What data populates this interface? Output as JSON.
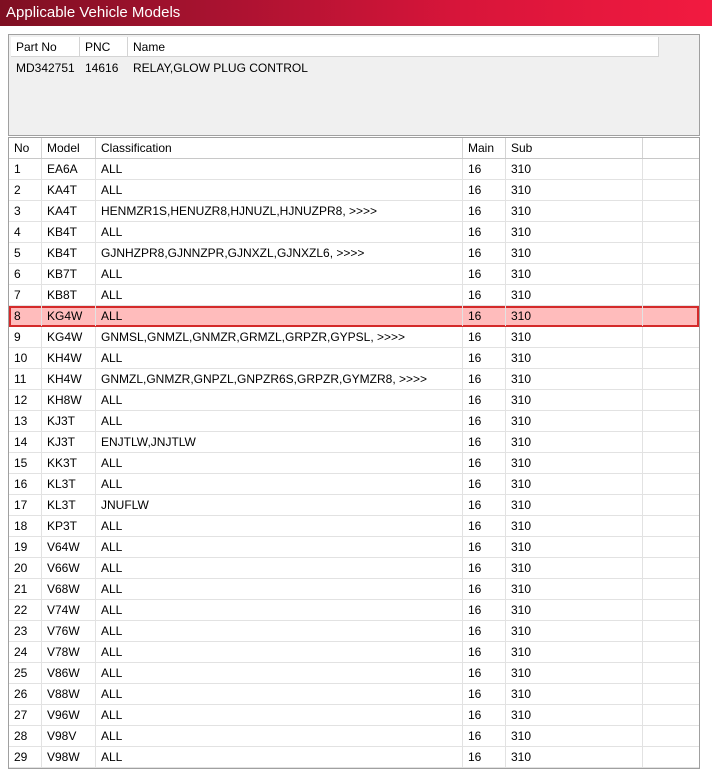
{
  "window": {
    "title": "Applicable Vehicle Models"
  },
  "part_panel": {
    "headers": {
      "part_no": "Part No",
      "pnc": "PNC",
      "name": "Name"
    },
    "row": {
      "part_no": "MD342751",
      "pnc": "14616",
      "name": "RELAY,GLOW PLUG CONTROL"
    }
  },
  "models_table": {
    "headers": {
      "no": "No",
      "model": "Model",
      "classification": "Classification",
      "main": "Main",
      "sub": "Sub"
    },
    "selected_index": 7,
    "rows": [
      {
        "no": "1",
        "model": "EA6A",
        "classification": "ALL",
        "main": "16",
        "sub": "310"
      },
      {
        "no": "2",
        "model": "KA4T",
        "classification": "ALL",
        "main": "16",
        "sub": "310"
      },
      {
        "no": "3",
        "model": "KA4T",
        "classification": "HENMZR1S,HENUZR8,HJNUZL,HJNUZPR8,  >>>>",
        "main": "16",
        "sub": "310"
      },
      {
        "no": "4",
        "model": "KB4T",
        "classification": "ALL",
        "main": "16",
        "sub": "310"
      },
      {
        "no": "5",
        "model": "KB4T",
        "classification": "GJNHZPR8,GJNNZPR,GJNXZL,GJNXZL6,  >>>>",
        "main": "16",
        "sub": "310"
      },
      {
        "no": "6",
        "model": "KB7T",
        "classification": "ALL",
        "main": "16",
        "sub": "310"
      },
      {
        "no": "7",
        "model": "KB8T",
        "classification": "ALL",
        "main": "16",
        "sub": "310"
      },
      {
        "no": "8",
        "model": "KG4W",
        "classification": "ALL",
        "main": "16",
        "sub": "310"
      },
      {
        "no": "9",
        "model": "KG4W",
        "classification": "GNMSL,GNMZL,GNMZR,GRMZL,GRPZR,GYPSL,  >>>>",
        "main": "16",
        "sub": "310"
      },
      {
        "no": "10",
        "model": "KH4W",
        "classification": "ALL",
        "main": "16",
        "sub": "310"
      },
      {
        "no": "11",
        "model": "KH4W",
        "classification": "GNMZL,GNMZR,GNPZL,GNPZR6S,GRPZR,GYMZR8,  >>>>",
        "main": "16",
        "sub": "310"
      },
      {
        "no": "12",
        "model": "KH8W",
        "classification": "ALL",
        "main": "16",
        "sub": "310"
      },
      {
        "no": "13",
        "model": "KJ3T",
        "classification": "ALL",
        "main": "16",
        "sub": "310"
      },
      {
        "no": "14",
        "model": "KJ3T",
        "classification": "ENJTLW,JNJTLW",
        "main": "16",
        "sub": "310"
      },
      {
        "no": "15",
        "model": "KK3T",
        "classification": "ALL",
        "main": "16",
        "sub": "310"
      },
      {
        "no": "16",
        "model": "KL3T",
        "classification": "ALL",
        "main": "16",
        "sub": "310"
      },
      {
        "no": "17",
        "model": "KL3T",
        "classification": "JNUFLW",
        "main": "16",
        "sub": "310"
      },
      {
        "no": "18",
        "model": "KP3T",
        "classification": "ALL",
        "main": "16",
        "sub": "310"
      },
      {
        "no": "19",
        "model": "V64W",
        "classification": "ALL",
        "main": "16",
        "sub": "310"
      },
      {
        "no": "20",
        "model": "V66W",
        "classification": "ALL",
        "main": "16",
        "sub": "310"
      },
      {
        "no": "21",
        "model": "V68W",
        "classification": "ALL",
        "main": "16",
        "sub": "310"
      },
      {
        "no": "22",
        "model": "V74W",
        "classification": "ALL",
        "main": "16",
        "sub": "310"
      },
      {
        "no": "23",
        "model": "V76W",
        "classification": "ALL",
        "main": "16",
        "sub": "310"
      },
      {
        "no": "24",
        "model": "V78W",
        "classification": "ALL",
        "main": "16",
        "sub": "310"
      },
      {
        "no": "25",
        "model": "V86W",
        "classification": "ALL",
        "main": "16",
        "sub": "310"
      },
      {
        "no": "26",
        "model": "V88W",
        "classification": "ALL",
        "main": "16",
        "sub": "310"
      },
      {
        "no": "27",
        "model": "V96W",
        "classification": "ALL",
        "main": "16",
        "sub": "310"
      },
      {
        "no": "28",
        "model": "V98V",
        "classification": "ALL",
        "main": "16",
        "sub": "310"
      },
      {
        "no": "29",
        "model": "V98W",
        "classification": "ALL",
        "main": "16",
        "sub": "310"
      }
    ]
  }
}
